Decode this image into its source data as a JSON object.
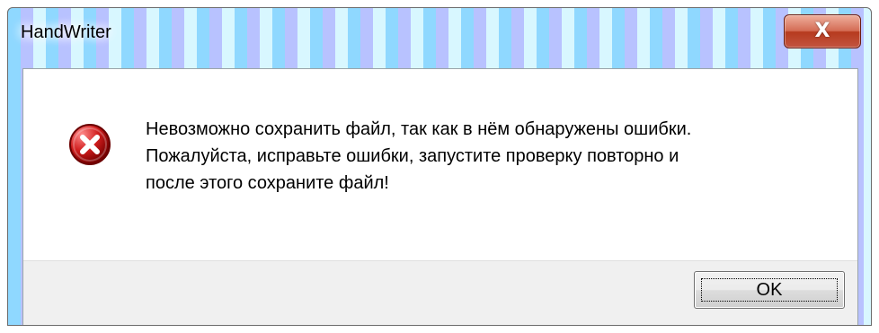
{
  "window": {
    "title": "HandWriter",
    "close_icon": "close-x-icon",
    "close_glyph": "X"
  },
  "dialog": {
    "icon": "error-icon",
    "message_lines": [
      "Невозможно сохранить файл, так как в нём обнаружены ошибки.",
      "Пожалуйста, исправьте ошибки, запустите проверку повторно и",
      "после этого сохраните файл!"
    ],
    "ok_label": "OK"
  },
  "colors": {
    "error_red": "#c4121a",
    "close_button_red": "#c35540",
    "footer_bg": "#f0f0f0"
  }
}
